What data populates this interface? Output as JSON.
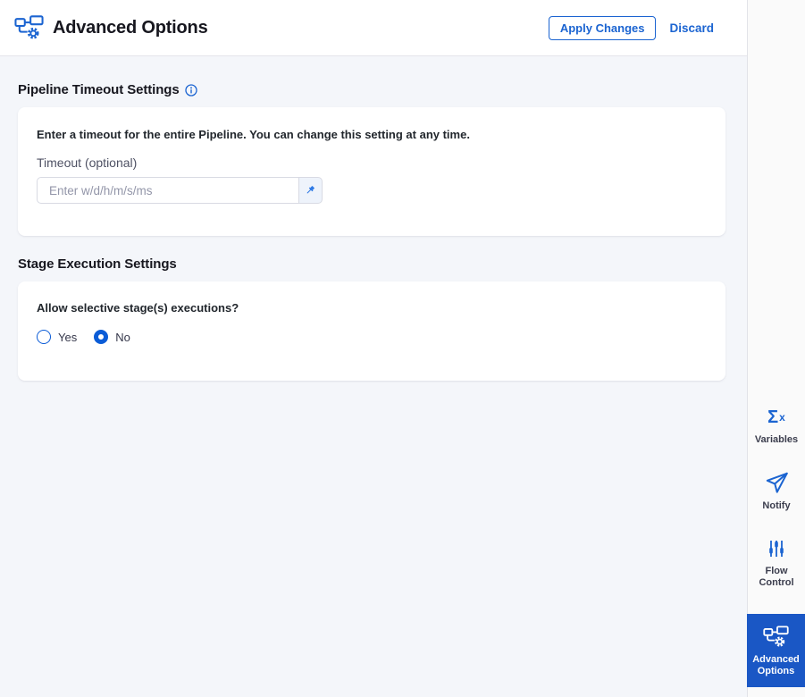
{
  "header": {
    "title": "Advanced Options",
    "apply_label": "Apply Changes",
    "discard_label": "Discard",
    "title_icon": "pipeline-gear-icon"
  },
  "sections": {
    "timeout": {
      "heading": "Pipeline Timeout Settings",
      "heading_icon": "info-icon",
      "description": "Enter a timeout for the entire Pipeline. You can change this setting at any time.",
      "label": "Timeout (optional)",
      "placeholder": "Enter w/d/h/m/s/ms",
      "value": "",
      "pin_icon": "pushpin-icon"
    },
    "stage": {
      "heading": "Stage Execution Settings",
      "question": "Allow selective stage(s) executions?",
      "options": [
        {
          "label": "Yes",
          "selected": false
        },
        {
          "label": "No",
          "selected": true
        }
      ]
    }
  },
  "sidebar": {
    "items": [
      {
        "label": "Variables",
        "icon": "sigma-x-icon",
        "active": false
      },
      {
        "label": "Notify",
        "icon": "paper-plane-icon",
        "active": false
      },
      {
        "label": "Flow Control",
        "icon": "sliders-icon",
        "active": false
      },
      {
        "label": "Advanced Options",
        "icon": "pipeline-gear-icon",
        "active": true
      }
    ]
  },
  "colors": {
    "accent_blue": "#1b64d1",
    "active_tile_blue": "#1a57c5",
    "radio_blue": "#0b5cd7",
    "content_bg": "#f4f6fa",
    "sidebar_bg": "#fafafa"
  }
}
